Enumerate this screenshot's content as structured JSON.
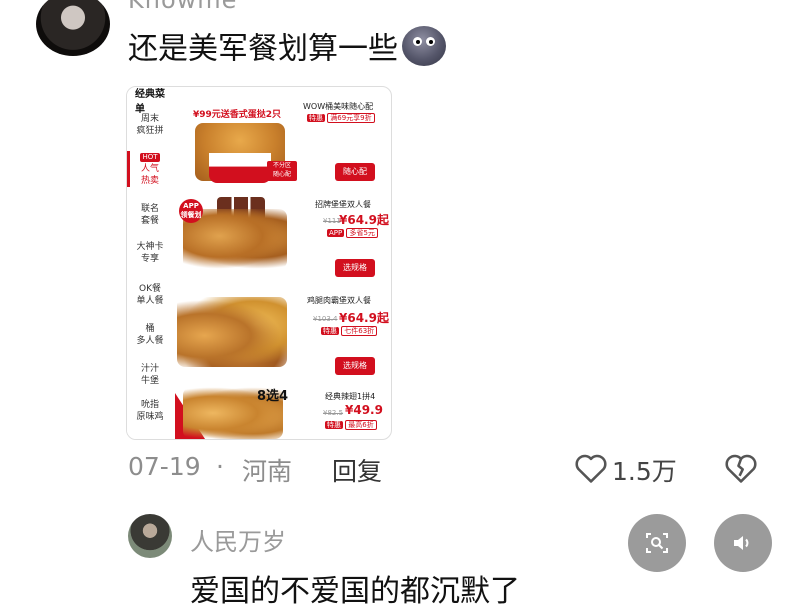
{
  "comment1": {
    "username": "Knowme",
    "text": "还是美军餐划算一些",
    "emoji": "new-moon-face-emoji"
  },
  "shot": {
    "tab": "经典菜单",
    "sidebar": [
      "周末\n疯狂拼",
      "人气\n热卖",
      "联名\n套餐",
      "大神卡\n专享",
      "OK餐\n单人餐",
      "桶\n多人餐",
      "汁汁\n牛堡",
      "吮指\n原味鸡"
    ],
    "hot_badge": "HOT",
    "promo": "¥99元送香式蛋挞2只",
    "sticker": "不分区\n随心配",
    "app_badge": "APP\n领餐划",
    "eight": "8选4",
    "items": [
      {
        "name": "WOW桶美味随心配",
        "tag1": "特惠",
        "tag2": "满69元享9折",
        "btn": "随心配"
      },
      {
        "name": "招牌堡堡双人餐",
        "old": "¥111",
        "price": "¥64.9起",
        "tag1": "APP",
        "tag2": "多省5元",
        "btn": "选规格"
      },
      {
        "name": "鸡腿肉霸堡双人餐",
        "old": "¥103.4",
        "price": "¥64.9起",
        "tag1": "特惠",
        "tag2": "七件63折",
        "btn": "选规格"
      },
      {
        "name": "经典辣翅1拼4",
        "old": "¥82.5",
        "price": "¥49.9",
        "tag1": "特惠",
        "tag2": "最高6折"
      }
    ]
  },
  "meta": {
    "date": "07-19",
    "dot": "·",
    "location": "河南",
    "reply": "回复",
    "likes": "1.5万"
  },
  "comment2": {
    "username": "人民万岁",
    "text": "爱国的不爱国的都沉默了"
  },
  "icons": {
    "like": "heart-outline-icon",
    "dislike": "broken-heart-icon",
    "search": "image-search-icon",
    "sound": "speaker-icon"
  },
  "colors": {
    "kfc_red": "#d20f1e",
    "meta_gray": "#8d8d8d",
    "fab_gray": "#9b9b9b"
  }
}
